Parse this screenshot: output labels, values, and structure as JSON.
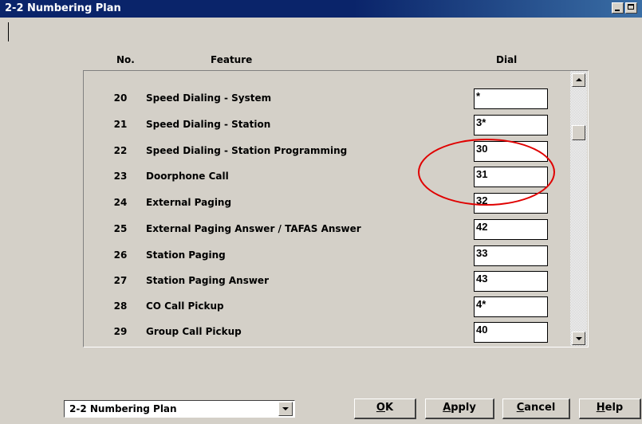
{
  "window": {
    "title": "2-2 Numbering Plan"
  },
  "columns": {
    "no": "No.",
    "feature": "Feature",
    "dial": "Dial"
  },
  "rows": [
    {
      "no": "20",
      "feature": "Speed Dialing - System",
      "dial": "*"
    },
    {
      "no": "21",
      "feature": "Speed Dialing - Station",
      "dial": "3*"
    },
    {
      "no": "22",
      "feature": "Speed Dialing - Station Programming",
      "dial": "30"
    },
    {
      "no": "23",
      "feature": "Doorphone Call",
      "dial": "31"
    },
    {
      "no": "24",
      "feature": "External Paging",
      "dial": "32"
    },
    {
      "no": "25",
      "feature": "External Paging Answer / TAFAS Answer",
      "dial": "42"
    },
    {
      "no": "26",
      "feature": "Station Paging",
      "dial": "33"
    },
    {
      "no": "27",
      "feature": "Station Paging Answer",
      "dial": "43"
    },
    {
      "no": "28",
      "feature": "CO Call Pickup",
      "dial": "4*"
    },
    {
      "no": "29",
      "feature": "Group Call Pickup",
      "dial": "40"
    }
  ],
  "footer": {
    "combo_value": "2-2 Numbering Plan",
    "ok_label": "OK",
    "apply_label": "Apply",
    "cancel_label": "Cancel",
    "help_label": "Help"
  },
  "colors": {
    "titlebar": "#0a246a",
    "highlight": "#e00000",
    "face": "#d4d0c8"
  },
  "icons": [
    "minimize-icon",
    "maximize-icon",
    "scroll-up-icon",
    "scroll-down-icon",
    "dropdown-arrow-icon"
  ]
}
